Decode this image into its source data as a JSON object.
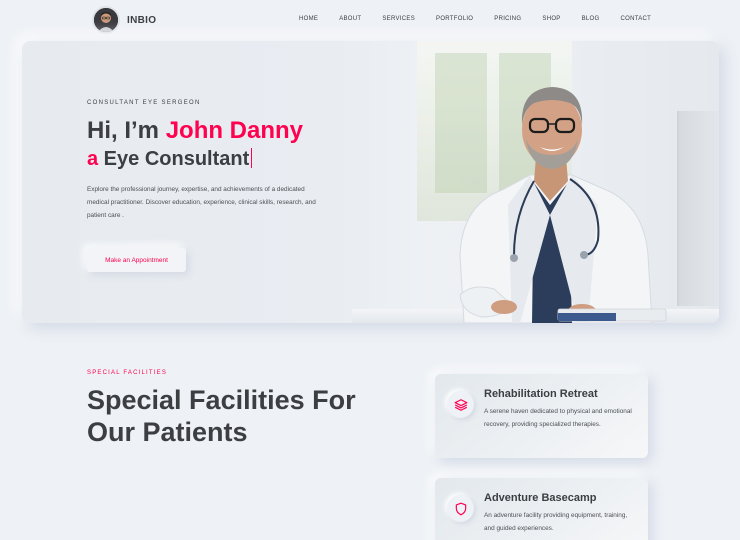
{
  "header": {
    "brand": "INBIO",
    "nav": [
      "HOME",
      "ABOUT",
      "SERVICES",
      "PORTFOLIO",
      "PRICING",
      "SHOP",
      "BLOG",
      "CONTACT"
    ]
  },
  "hero": {
    "eyebrow": "CONSULTANT EYE SERGEON",
    "greeting": "Hi, I’m ",
    "name": "John Danny",
    "role_prefix": "a",
    "role": " Eye Consultant",
    "description": "Explore the professional journey, expertise, and achievements of a dedicated medical practitioner. Discover education, experience, clinical skills, research, and patient care .",
    "cta": "Make an Appointment",
    "image_icon": "doctor-portrait"
  },
  "facilities": {
    "eyebrow": "SPECIAL FACILITIES",
    "title": "Special Facilities For Our Patients",
    "cards": [
      {
        "icon": "layers-icon",
        "title": "Rehabilitation Retreat",
        "description": "A serene haven dedicated to physical and emotional recovery, providing specialized therapies."
      },
      {
        "icon": "shield-icon",
        "title": "Adventure Basecamp",
        "description": "An adventure facility providing equipment, training, and guided experiences."
      }
    ]
  },
  "colors": {
    "accent": "#ff014f",
    "background": "#eef1f5",
    "text": "#3c3e41"
  }
}
